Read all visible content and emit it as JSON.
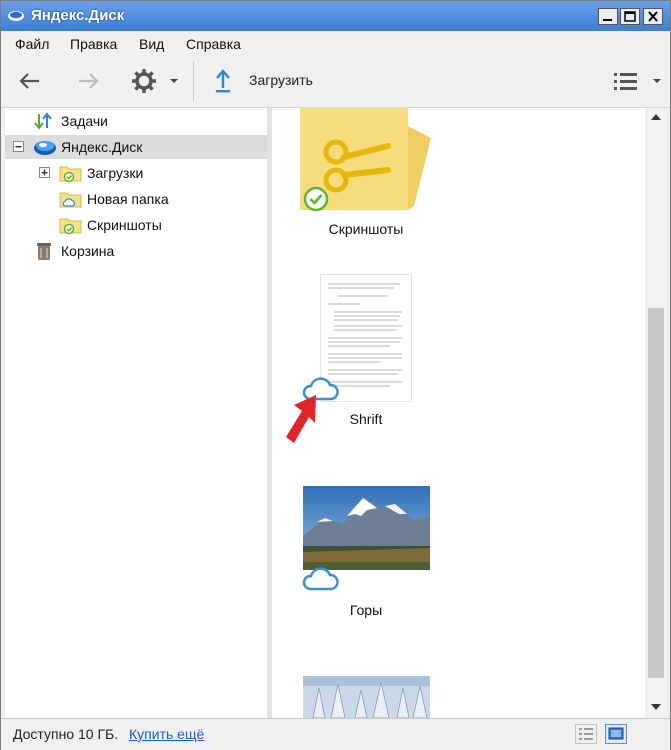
{
  "window": {
    "title": "Яндекс.Диск"
  },
  "menu": [
    {
      "label": "Файл"
    },
    {
      "label": "Правка"
    },
    {
      "label": "Вид"
    },
    {
      "label": "Справка"
    }
  ],
  "toolbar": {
    "upload_label": "Загрузить"
  },
  "sidebar": {
    "items": [
      {
        "label": "Задачи"
      },
      {
        "label": "Яндекс.Диск"
      },
      {
        "label": "Загрузки"
      },
      {
        "label": "Новая папка"
      },
      {
        "label": "Скриншоты"
      },
      {
        "label": "Корзина"
      }
    ]
  },
  "content": {
    "items": [
      {
        "name": "Скриншоты"
      },
      {
        "name": "Shrift"
      },
      {
        "name": "Горы"
      }
    ]
  },
  "status": {
    "available": "Доступно 10 ГБ.",
    "buy_more": "Купить ещё"
  },
  "colors": {
    "accent": "#3d7fd8",
    "folder": "#f9e08a",
    "cloud": "#3b8fd9",
    "sync_ok": "#5cb82f",
    "arrow_red": "#e0262b"
  }
}
